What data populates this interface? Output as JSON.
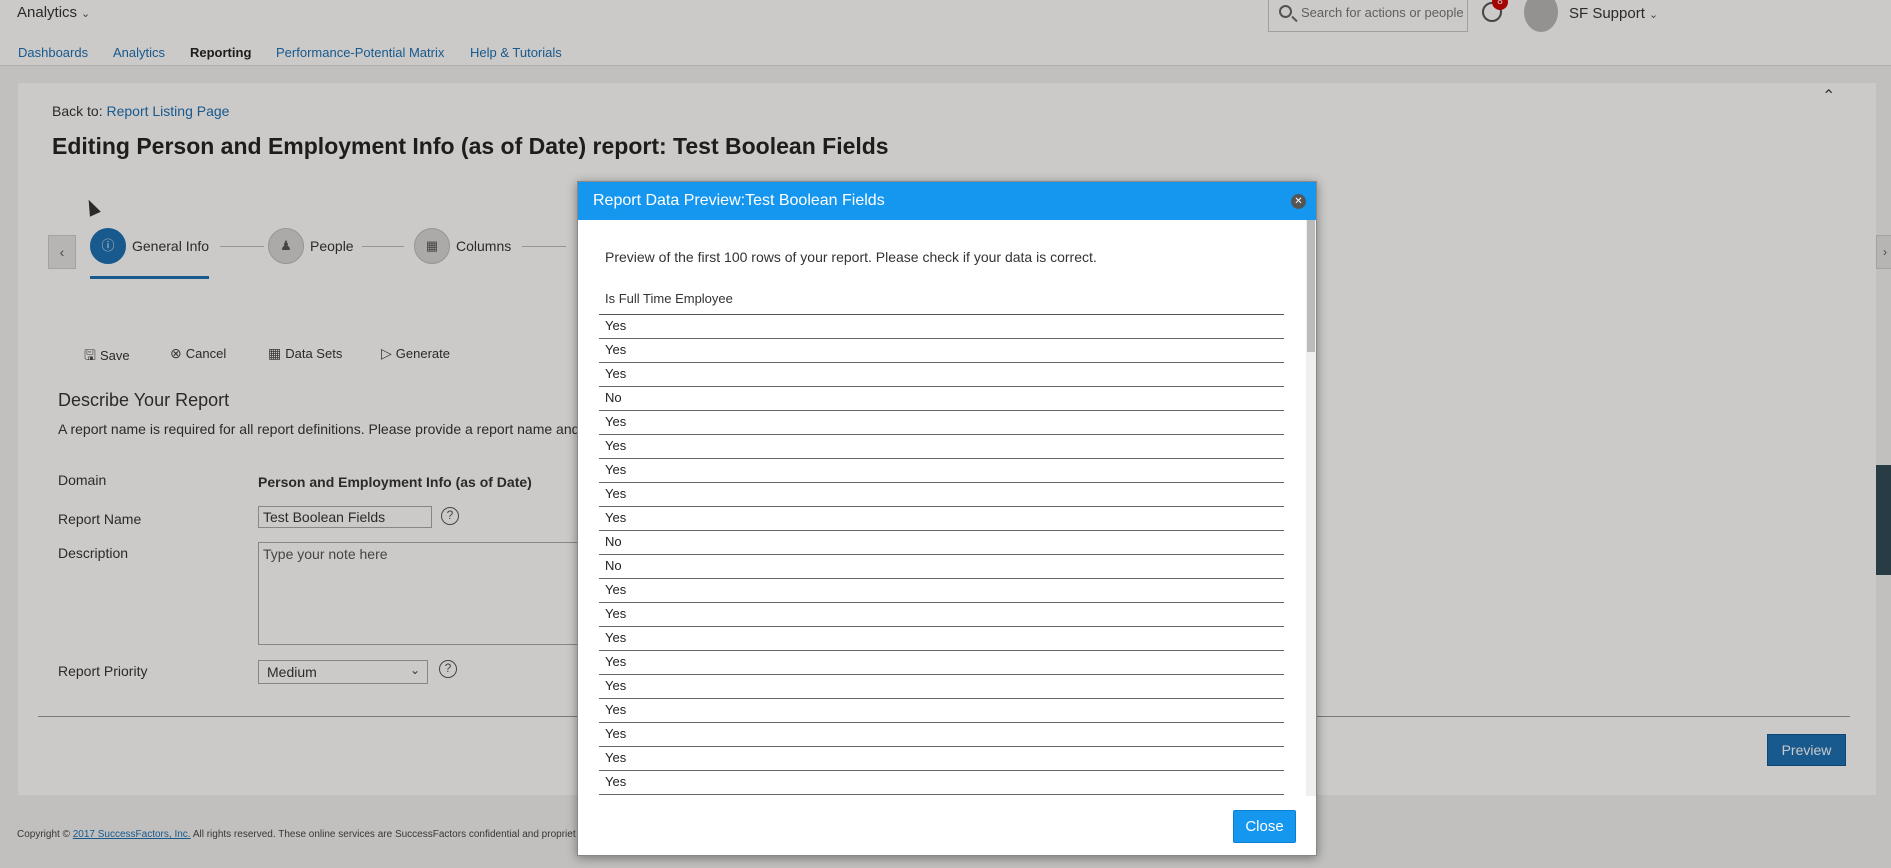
{
  "topbar": {
    "app_name": "Analytics",
    "search_placeholder": "Search for actions or people",
    "notification_count": "8",
    "user_name": "SF Support"
  },
  "nav": {
    "items": [
      {
        "label": "Dashboards"
      },
      {
        "label": "Analytics"
      },
      {
        "label": "Reporting",
        "active": true
      },
      {
        "label": "Performance-Potential Matrix"
      },
      {
        "label": "Help & Tutorials"
      }
    ]
  },
  "page": {
    "back_prefix": "Back to:",
    "back_link": "Report Listing Page",
    "title": "Editing Person and Employment Info (as of Date) report: Test Boolean Fields"
  },
  "wizard": {
    "steps": [
      {
        "label": "General Info",
        "icon": "info-icon",
        "active": true
      },
      {
        "label": "People",
        "icon": "people-icon"
      },
      {
        "label": "Columns",
        "icon": "columns-icon"
      }
    ]
  },
  "toolbar": {
    "save": "Save",
    "cancel": "Cancel",
    "data_sets": "Data Sets",
    "generate": "Generate"
  },
  "describe": {
    "title": "Describe Your Report",
    "description": "A report name is required for all report definitions. Please provide a report name and",
    "domain_label": "Domain",
    "domain_value": "Person and Employment Info (as of Date)",
    "name_label": "Report Name",
    "name_value": "Test Boolean Fields",
    "desc_label": "Description",
    "desc_placeholder": "Type your note here",
    "priority_label": "Report Priority",
    "priority_value": "Medium"
  },
  "preview_button": "Preview",
  "footer": {
    "prefix": "Copyright ©",
    "link": "2017 SuccessFactors, Inc.",
    "text": "All rights reserved. These online services are SuccessFactors confidential and propriet"
  },
  "modal": {
    "title": "Report Data Preview:Test Boolean Fields",
    "description": "Preview of the first 100 rows of your report. Please check if your data is correct.",
    "column_header": "Is Full Time Employee",
    "rows": [
      "Yes",
      "Yes",
      "Yes",
      "No",
      "Yes",
      "Yes",
      "Yes",
      "Yes",
      "Yes",
      "No",
      "No",
      "Yes",
      "Yes",
      "Yes",
      "Yes",
      "Yes",
      "Yes",
      "Yes",
      "Yes",
      "Yes"
    ],
    "close_label": "Close"
  },
  "colors": {
    "accent": "#1597f0",
    "primary_button": "#1a6fb5"
  }
}
